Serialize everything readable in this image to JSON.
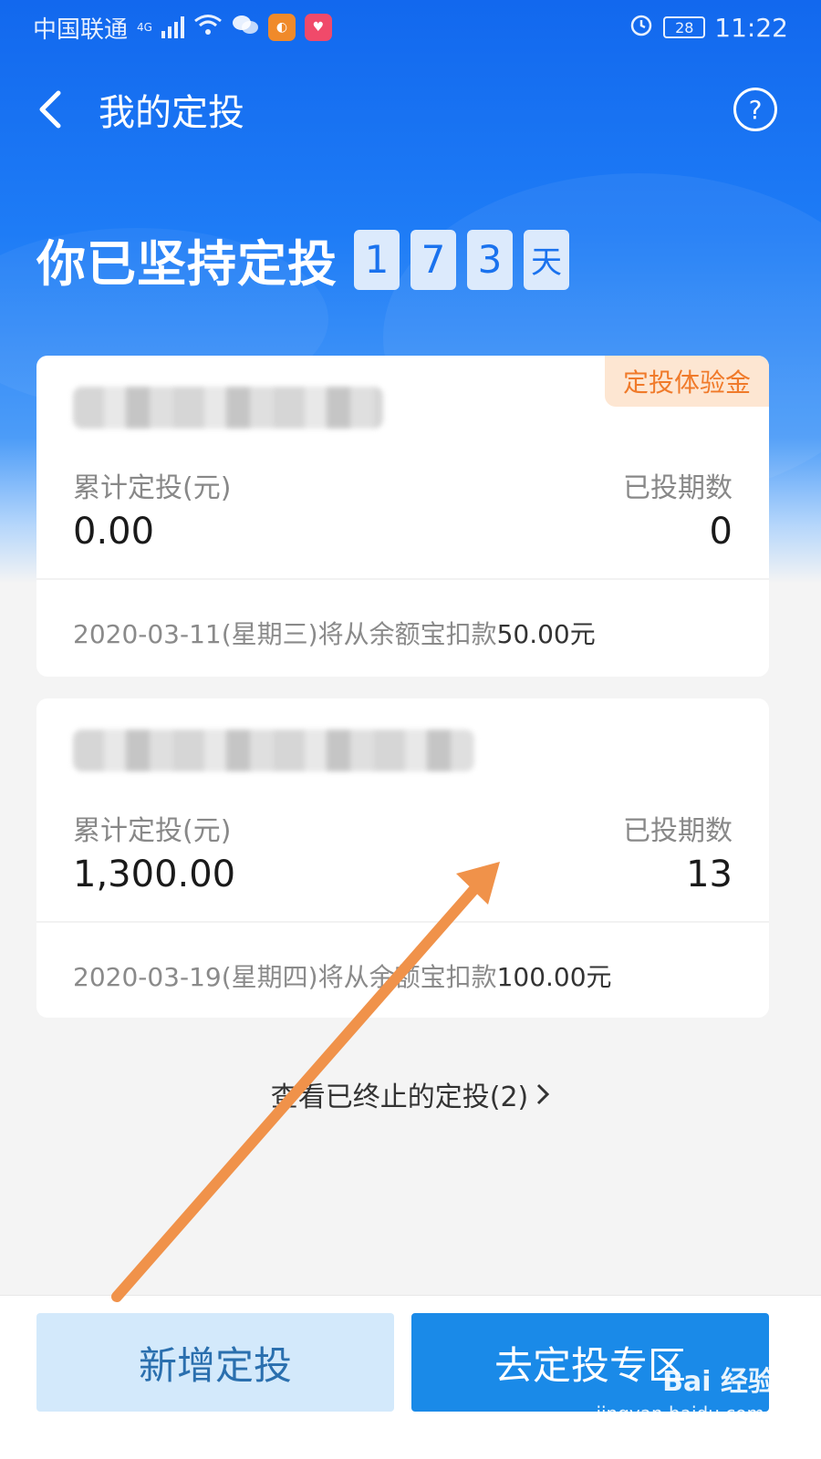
{
  "status_bar": {
    "carrier": "中国联通",
    "network": "4G",
    "battery": "28",
    "time": "11:22"
  },
  "nav": {
    "title": "我的定投",
    "help_symbol": "?"
  },
  "streak": {
    "text": "你已坚持定投",
    "digits": [
      "1",
      "7",
      "3"
    ],
    "unit": "天"
  },
  "cards": [
    {
      "tag": "定投体验金",
      "label_total": "累计定投(元)",
      "total": "0.00",
      "label_periods": "已投期数",
      "periods": "0",
      "note_prefix": "2020-03-11(星期三)将从余额宝扣款",
      "note_amount": "50.00元"
    },
    {
      "label_total": "累计定投(元)",
      "total": "1,300.00",
      "label_periods": "已投期数",
      "periods": "13",
      "note_prefix": "2020-03-19(星期四)将从余额宝扣款",
      "note_amount": "100.00元"
    }
  ],
  "terminated_link": "查看已终止的定投(2)",
  "buttons": {
    "add": "新增定投",
    "zone": "去定投专区"
  },
  "watermark": {
    "brand": "Bai 经验",
    "url": "jingyan.baidu.com"
  },
  "colors": {
    "primary_blue": "#1a72ee",
    "tag_orange": "#f07a2a",
    "arrow_orange": "#f0924a",
    "button_blue": "#1a8ae8"
  }
}
